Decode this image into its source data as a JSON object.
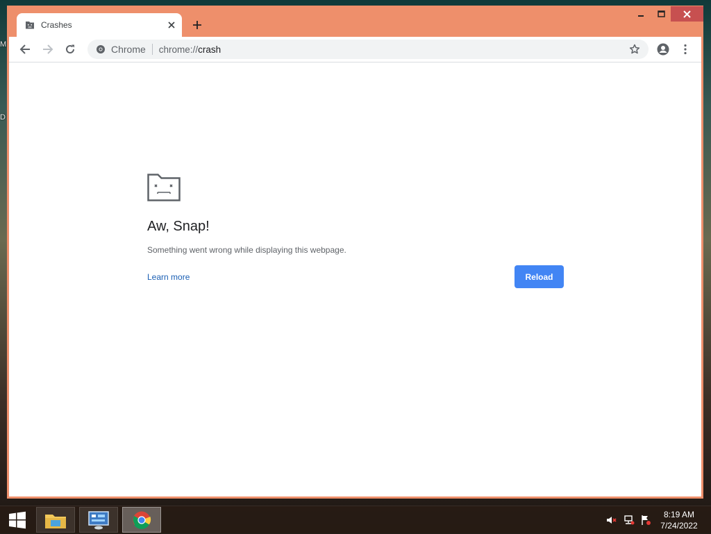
{
  "desktop": {
    "glyph_top": "M",
    "glyph_mid": "D"
  },
  "tab": {
    "title": "Crashes"
  },
  "omnibox": {
    "chip": "Chrome",
    "scheme": "chrome://",
    "host": "crash"
  },
  "error": {
    "title": "Aw, Snap!",
    "message": "Something went wrong while displaying this webpage.",
    "learn_more": "Learn more",
    "reload": "Reload"
  },
  "taskbar": {
    "time": "8:19 AM",
    "date": "7/24/2022"
  },
  "colors": {
    "frame": "#ee8f6b",
    "close": "#c75050",
    "accent": "#4285f4",
    "link": "#1a5fb4"
  }
}
